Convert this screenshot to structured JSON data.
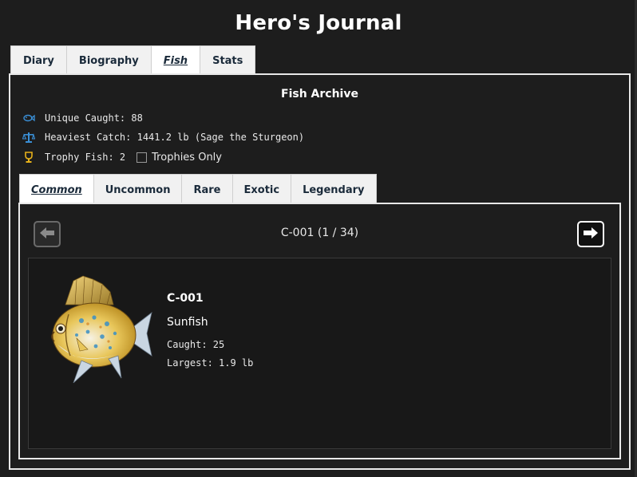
{
  "app": {
    "title": "Hero's Journal"
  },
  "main_tabs": [
    {
      "label": "Diary"
    },
    {
      "label": "Biography"
    },
    {
      "label": "Fish"
    },
    {
      "label": "Stats"
    }
  ],
  "main_tabs_active": "Fish",
  "archive": {
    "title": "Fish Archive",
    "unique_caught": "Unique Caught: 88",
    "heaviest_catch": "Heaviest Catch: 1441.2 lb (Sage the Sturgeon)",
    "trophy_fish": "Trophy Fish: 2",
    "trophies_only_label": "Trophies Only",
    "trophies_only_checked": false
  },
  "rarity_tabs": [
    {
      "label": "Common"
    },
    {
      "label": "Uncommon"
    },
    {
      "label": "Rare"
    },
    {
      "label": "Exotic"
    },
    {
      "label": "Legendary"
    }
  ],
  "rarity_tabs_active": "Common",
  "pager": {
    "label": "C-001  (1 / 34)",
    "current": 1,
    "total": 34
  },
  "fish": {
    "id": "C-001",
    "name": "Sunfish",
    "caught": "Caught: 25",
    "largest": "Largest: 1.9 lb"
  },
  "icons": {
    "unique": "fish-icon",
    "heaviest": "scale-icon",
    "trophy": "trophy-icon",
    "prev": "arrow-left-icon",
    "next": "arrow-right-icon"
  },
  "colors": {
    "background": "#1d1d1d",
    "tab_bg": "#f1f1f1",
    "tab_text": "#1a2a3a",
    "icon_blue": "#3a8fd6",
    "icon_gold": "#e8b21a"
  }
}
